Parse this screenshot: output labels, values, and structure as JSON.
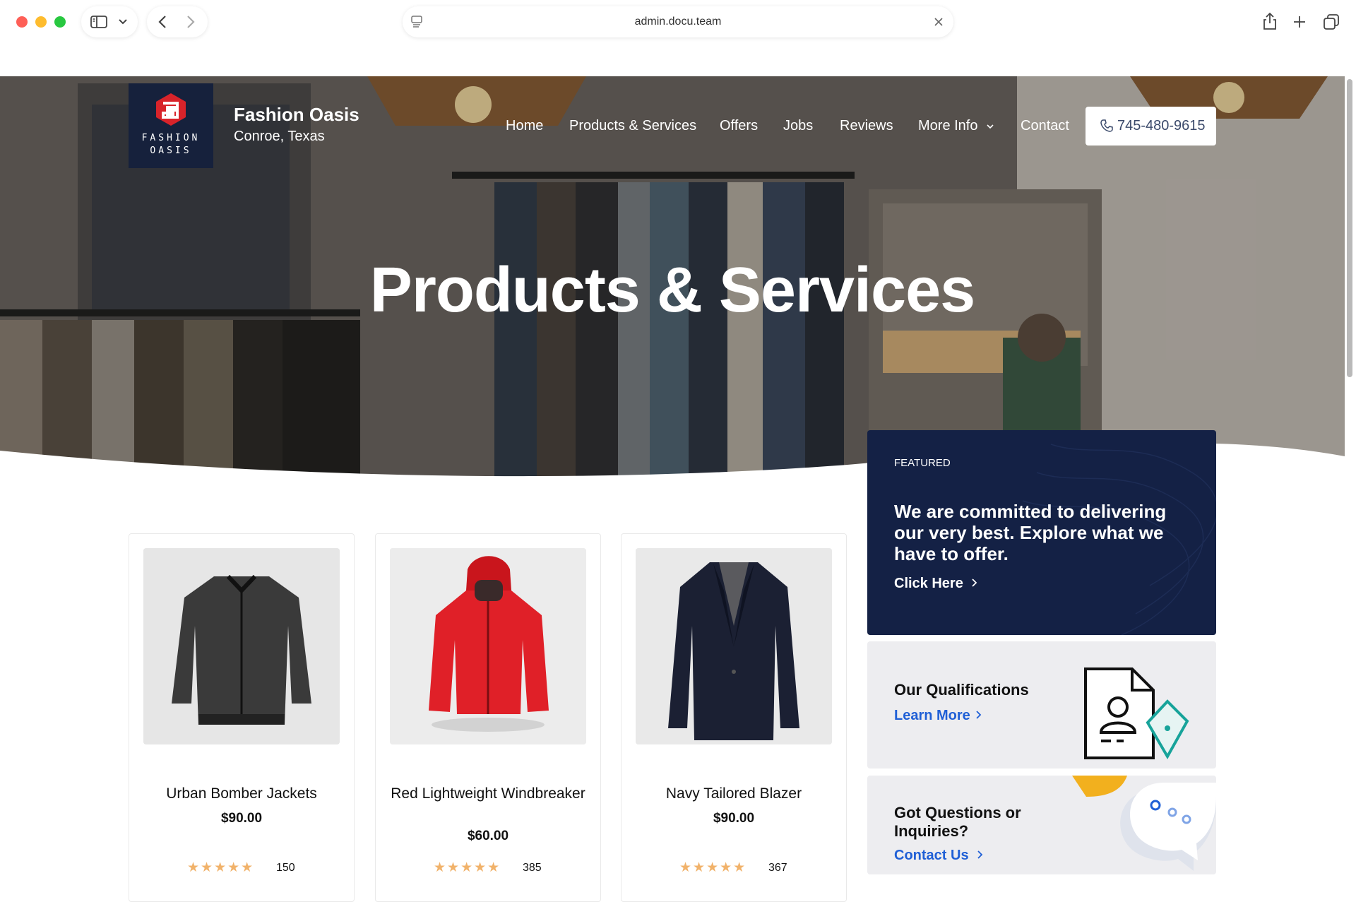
{
  "browser": {
    "url": "admin.docu.team"
  },
  "site": {
    "brand_name": "Fashion Oasis",
    "brand_location": "Conroe, Texas",
    "logo_text_line1": "FASHION",
    "logo_text_line2": "OASIS",
    "nav": {
      "home": "Home",
      "products": "Products & Services",
      "offers": "Offers",
      "jobs": "Jobs",
      "reviews": "Reviews",
      "more": "More Info",
      "contact": "Contact"
    },
    "phone": "745-480-9615",
    "hero_title": "Products & Services"
  },
  "products": [
    {
      "name": "Urban Bomber Jackets",
      "price": "$90.00",
      "reviews": "150",
      "stars": 5
    },
    {
      "name": "Red Lightweight Windbreaker",
      "price": "$60.00",
      "reviews": "385",
      "stars": 5
    },
    {
      "name": "Navy Tailored Blazer",
      "price": "$90.00",
      "reviews": "367",
      "stars": 5
    }
  ],
  "sidebar": {
    "featured_label": "FEATURED",
    "featured_text": "We are committed to delivering our very best. Explore what we have to offer.",
    "featured_link": "Click Here",
    "qualifications_title": "Our Qualifications",
    "qualifications_link": "Learn More",
    "questions_title": "Got Questions or Inquiries?",
    "questions_link": "Contact Us"
  },
  "colors": {
    "navy": "#142145",
    "link_blue": "#1f5fd6",
    "star": "#f1b26a",
    "logo_red": "#d8232a"
  }
}
